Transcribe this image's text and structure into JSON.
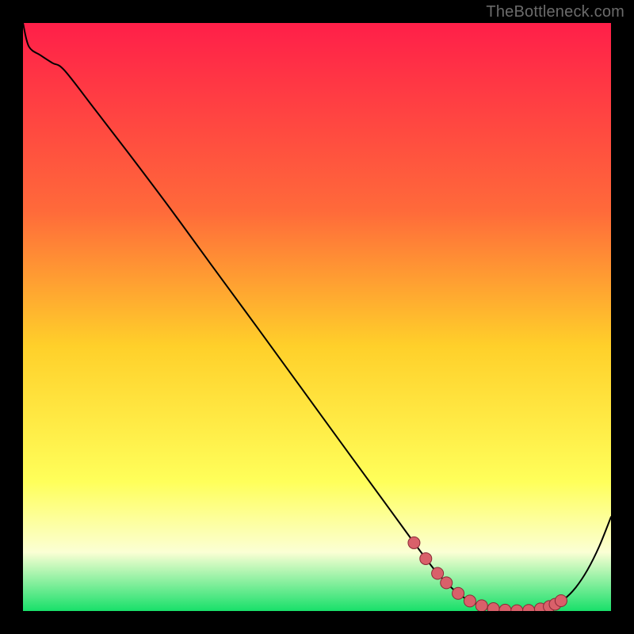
{
  "watermark": "TheBottleneck.com",
  "colors": {
    "grad_top": "#ff1f49",
    "grad_upper": "#ff6a3a",
    "grad_mid": "#ffd02a",
    "grad_lower_yellow": "#ffff5a",
    "grad_pale": "#fbffd4",
    "grad_green": "#18e06a",
    "curve": "#000000",
    "marker_fill": "#d9606a",
    "marker_stroke": "#8a2a36"
  },
  "chart_data": {
    "type": "line",
    "title": "",
    "xlabel": "",
    "ylabel": "",
    "xlim": [
      0,
      100
    ],
    "ylim": [
      0,
      100
    ],
    "curve_x": [
      0,
      1,
      3,
      5,
      7,
      12,
      18,
      25,
      32,
      40,
      48,
      56,
      62,
      66,
      68,
      70,
      72,
      74,
      76,
      78,
      80,
      82,
      84,
      86,
      88,
      90,
      92,
      94,
      96,
      98,
      100
    ],
    "curve_y": [
      100,
      96,
      94.5,
      93.2,
      92.0,
      85.6,
      77.8,
      68.5,
      58.9,
      48.0,
      37.0,
      26.0,
      17.8,
      12.3,
      9.6,
      7.0,
      4.8,
      3.0,
      1.7,
      0.9,
      0.4,
      0.15,
      0.05,
      0.1,
      0.35,
      0.9,
      2.0,
      4.0,
      7.0,
      11.0,
      16.0
    ],
    "markers_x": [
      66.5,
      68.5,
      70.5,
      72.0,
      74.0,
      76.0,
      78.0,
      80.0,
      82.0,
      84.0,
      86.0,
      88.0,
      89.5,
      90.5,
      91.5
    ],
    "markers_y": [
      11.6,
      8.9,
      6.4,
      4.8,
      3.0,
      1.7,
      0.9,
      0.4,
      0.15,
      0.05,
      0.1,
      0.35,
      0.75,
      1.15,
      1.75
    ]
  }
}
